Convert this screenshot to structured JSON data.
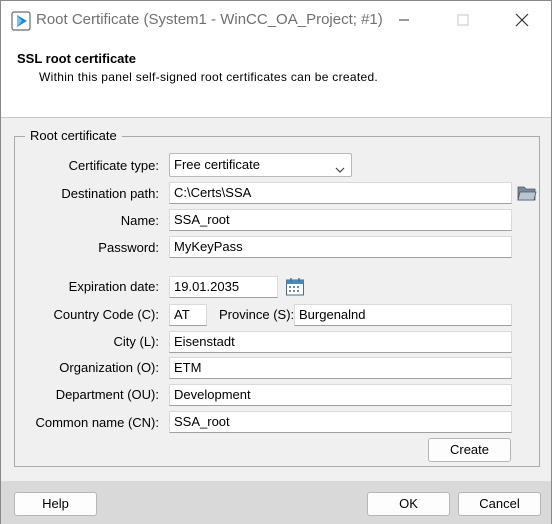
{
  "window": {
    "title": "Root Certificate (System1 - WinCC_OA_Project; #1)"
  },
  "header": {
    "title": "SSL root certificate",
    "subtitle": "Within this panel self-signed root certificates can be created."
  },
  "group": {
    "title": "Root certificate"
  },
  "form": {
    "certificate_type": {
      "label": "Certificate type:",
      "value": "Free certificate"
    },
    "destination_path": {
      "label": "Destination path:",
      "value": "C:\\Certs\\SSA"
    },
    "name": {
      "label": "Name:",
      "value": "SSA_root"
    },
    "password": {
      "label": "Password:",
      "value": "MyKeyPass"
    },
    "expiration_date": {
      "label": "Expiration date:",
      "value": "19.01.2035"
    },
    "country_code": {
      "label": "Country Code (C):",
      "value": "AT"
    },
    "province": {
      "label": "Province (S):",
      "value": "Burgenalnd"
    },
    "city": {
      "label": "City (L):",
      "value": "Eisenstadt"
    },
    "organization": {
      "label": "Organization (O):",
      "value": "ETM"
    },
    "department": {
      "label": "Department (OU):",
      "value": "Development"
    },
    "common_name": {
      "label": "Common name (CN):",
      "value": "SSA_root"
    }
  },
  "buttons": {
    "create": "Create",
    "help": "Help",
    "ok": "OK",
    "cancel": "Cancel"
  },
  "icons": {
    "app": "wincc-play-icon",
    "folder": "folder-open-icon",
    "calendar": "calendar-icon"
  },
  "colors": {
    "accent": "#1e88c8",
    "footer_bg": "#d9d9d9"
  }
}
